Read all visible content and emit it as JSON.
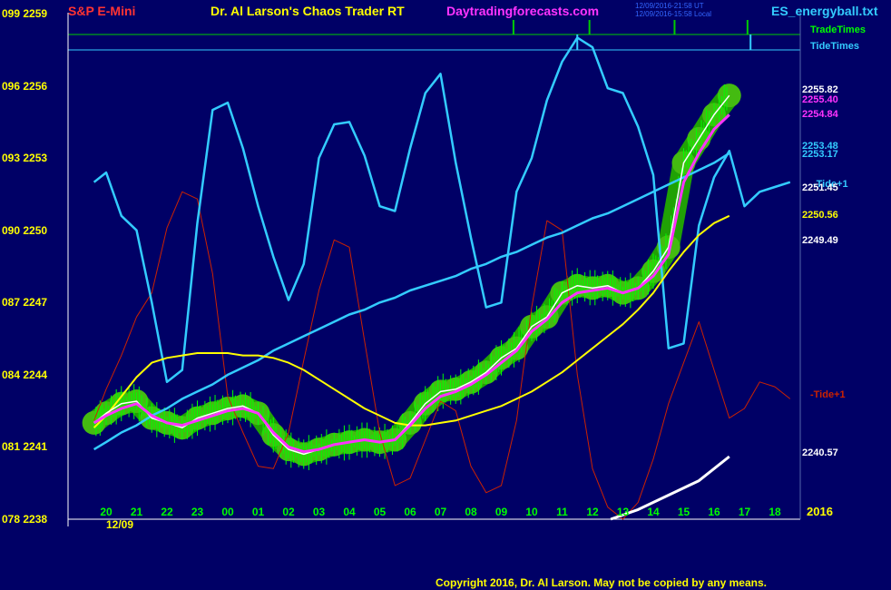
{
  "header": {
    "symbol": "S&P E-Mini",
    "title": "Dr. Al Larson's Chaos Trader RT",
    "site": "Daytradingforecasts.com",
    "stamp1": "12/09/2016-21:58 UT",
    "stamp2": "12/09/2016-15:58 Local",
    "file": "ES_energyball.txt"
  },
  "footer": {
    "copyright": "Copyright 2016, Dr. Al Larson. May not be copied by any means."
  },
  "colors": {
    "background": "#000066",
    "price_bars": "#00FF00",
    "energy_ball": "#22AA00",
    "tide": "#33CCFF",
    "tide_plus1": "#CC2200",
    "avg_fast": "#FF33FF",
    "avg_slow": "#FFFF00",
    "trend": "#33CCFF",
    "white_lines": "#FFFFFF",
    "trade_times": "#00CC00"
  },
  "chart_data": {
    "type": "line",
    "title": "S&P E-Mini",
    "xlabel": "",
    "ylabel": "",
    "ylim": [
      2238,
      2259
    ],
    "y_ticks": [
      {
        "left": "099",
        "right": "2259"
      },
      {
        "left": "096",
        "right": "2256"
      },
      {
        "left": "093",
        "right": "2253"
      },
      {
        "left": "090",
        "right": "2250"
      },
      {
        "left": "087",
        "right": "2247"
      },
      {
        "left": "084",
        "right": "2244"
      },
      {
        "left": "081",
        "right": "2241"
      },
      {
        "left": "078",
        "right": "2238"
      }
    ],
    "x_ticks": [
      "20",
      "21",
      "22",
      "23",
      "00",
      "01",
      "02",
      "03",
      "04",
      "05",
      "06",
      "07",
      "08",
      "09",
      "10",
      "11",
      "12",
      "13",
      "14",
      "15",
      "16",
      "17",
      "18"
    ],
    "date_label": "12/09",
    "year_label": "2016",
    "legend": [
      "TradeTimes",
      "TideTimes"
    ],
    "right_labels": [
      {
        "text": "2255.82",
        "color": "#FFFFFF"
      },
      {
        "text": "2255.40",
        "color": "#FF33FF"
      },
      {
        "text": "2254.84",
        "color": "#FF33FF"
      },
      {
        "text": "2253.48",
        "color": "#33CCFF"
      },
      {
        "text": "2253.17",
        "color": "#33CCFF"
      },
      {
        "text": "-Tide+1",
        "color": "#33CCFF"
      },
      {
        "text": "2251.45",
        "color": "#FFFFFF"
      },
      {
        "text": "2250.56",
        "color": "#FFFF00"
      },
      {
        "text": "2249.49",
        "color": "#FFFFFF"
      },
      {
        "text": "-Tide+1",
        "color": "#CC2200"
      },
      {
        "text": "2240.57",
        "color": "#FFFFFF"
      }
    ],
    "series": [
      {
        "name": "Price",
        "x": [
          19.6,
          20,
          20.5,
          21,
          21.5,
          22,
          22.5,
          23,
          23.5,
          0,
          0.5,
          1,
          1.5,
          2,
          2.5,
          3,
          3.5,
          4,
          4.5,
          5,
          5.5,
          6,
          6.5,
          7,
          7.5,
          8,
          8.5,
          9,
          9.5,
          10,
          10.5,
          11,
          11.5,
          12,
          12.5,
          13,
          13.5,
          14,
          14.5,
          15,
          15.5,
          16,
          16.5
        ],
        "y": [
          2242.0,
          2242.4,
          2242.8,
          2242.9,
          2242.2,
          2242.0,
          2241.8,
          2242.2,
          2242.4,
          2242.6,
          2242.7,
          2242.4,
          2241.5,
          2240.9,
          2240.7,
          2240.9,
          2241.1,
          2241.2,
          2241.3,
          2241.2,
          2241.3,
          2242.0,
          2242.8,
          2243.3,
          2243.4,
          2243.7,
          2244.1,
          2244.7,
          2245.1,
          2246.0,
          2246.4,
          2247.4,
          2247.7,
          2247.6,
          2247.7,
          2247.4,
          2247.6,
          2248.3,
          2249.3,
          2252.8,
          2253.8,
          2254.8,
          2255.6
        ]
      },
      {
        "name": "Fast Average",
        "x": [
          19.6,
          20,
          20.5,
          21,
          21.5,
          22,
          22.5,
          23,
          23.5,
          0,
          0.5,
          1,
          1.5,
          2,
          2.5,
          3,
          3.5,
          4,
          4.5,
          5,
          5.5,
          6,
          6.5,
          7,
          7.5,
          8,
          8.5,
          9,
          9.5,
          10,
          10.5,
          11,
          11.5,
          12,
          12.5,
          13,
          13.5,
          14,
          14.5,
          15,
          15.5,
          16,
          16.5
        ],
        "y": [
          2242.0,
          2242.3,
          2242.6,
          2242.8,
          2242.3,
          2242.0,
          2241.9,
          2242.1,
          2242.3,
          2242.5,
          2242.6,
          2242.4,
          2241.6,
          2241.0,
          2240.8,
          2240.9,
          2241.1,
          2241.2,
          2241.3,
          2241.2,
          2241.3,
          2241.9,
          2242.6,
          2243.1,
          2243.3,
          2243.6,
          2244.0,
          2244.5,
          2245.0,
          2245.8,
          2246.3,
          2247.0,
          2247.4,
          2247.5,
          2247.6,
          2247.4,
          2247.6,
          2248.1,
          2249.0,
          2252.0,
          2253.2,
          2254.2,
          2254.8
        ]
      },
      {
        "name": "Slow Average",
        "x": [
          19.6,
          20,
          20.5,
          21,
          21.5,
          22,
          22.5,
          23,
          23.5,
          0,
          0.5,
          1,
          1.5,
          2,
          2.5,
          3,
          3.5,
          4,
          4.5,
          5,
          5.5,
          6,
          6.5,
          7,
          7.5,
          8,
          8.5,
          9,
          9.5,
          10,
          10.5,
          11,
          11.5,
          12,
          12.5,
          13,
          13.5,
          14,
          14.5,
          15,
          15.5,
          16,
          16.5
        ],
        "y": [
          2241.8,
          2242.3,
          2243.1,
          2243.9,
          2244.5,
          2244.7,
          2244.8,
          2244.9,
          2244.9,
          2244.9,
          2244.8,
          2244.8,
          2244.7,
          2244.5,
          2244.2,
          2243.8,
          2243.4,
          2243.0,
          2242.6,
          2242.3,
          2242.0,
          2241.9,
          2241.9,
          2242.0,
          2242.1,
          2242.3,
          2242.5,
          2242.7,
          2243.0,
          2243.3,
          2243.7,
          2244.1,
          2244.6,
          2245.1,
          2245.6,
          2246.1,
          2246.7,
          2247.4,
          2248.3,
          2249.1,
          2249.8,
          2250.3,
          2250.6
        ]
      },
      {
        "name": "Trend",
        "x": [
          19.6,
          20,
          20.5,
          21,
          21.5,
          22,
          22.5,
          23,
          23.5,
          0,
          0.5,
          1,
          1.5,
          2,
          2.5,
          3,
          3.5,
          4,
          4.5,
          5,
          5.5,
          6,
          6.5,
          7,
          7.5,
          8,
          8.5,
          9,
          9.5,
          10,
          10.5,
          11,
          11.5,
          12,
          12.5,
          13,
          13.5,
          14,
          14.5,
          15,
          15.5,
          16,
          16.5
        ],
        "y": [
          2240.9,
          2241.2,
          2241.6,
          2241.9,
          2242.3,
          2242.6,
          2243.0,
          2243.3,
          2243.6,
          2244.0,
          2244.3,
          2244.6,
          2245.0,
          2245.3,
          2245.6,
          2245.9,
          2246.2,
          2246.5,
          2246.7,
          2247.0,
          2247.2,
          2247.5,
          2247.7,
          2247.9,
          2248.1,
          2248.4,
          2248.6,
          2248.9,
          2249.1,
          2249.4,
          2249.7,
          2249.9,
          2250.2,
          2250.5,
          2250.7,
          2251.0,
          2251.3,
          2251.6,
          2251.9,
          2252.2,
          2252.5,
          2252.8,
          2253.2
        ]
      },
      {
        "name": "Tide",
        "x": [
          19.6,
          20,
          20.5,
          21,
          21.5,
          22,
          22.5,
          23,
          23.5,
          0,
          0.5,
          1,
          1.5,
          2,
          2.5,
          3,
          3.5,
          4,
          4.5,
          5,
          5.5,
          6,
          6.5,
          7,
          7.5,
          8,
          8.5,
          9,
          9.5,
          10,
          10.5,
          11,
          11.5,
          12,
          12.5,
          13,
          13.5,
          14,
          14.5,
          15,
          15.5,
          16,
          16.5,
          17,
          17.5,
          18,
          18.5
        ],
        "y": [
          2252.0,
          2252.4,
          2250.6,
          2250.0,
          2247.0,
          2243.7,
          2244.2,
          2250.3,
          2255.0,
          2255.3,
          2253.4,
          2251.0,
          2248.9,
          2247.1,
          2248.6,
          2253.0,
          2254.4,
          2254.5,
          2253.1,
          2251.0,
          2250.8,
          2253.4,
          2255.7,
          2256.5,
          2252.8,
          2249.7,
          2246.8,
          2247.0,
          2251.6,
          2253.0,
          2255.4,
          2257.0,
          2258.0,
          2257.6,
          2255.9,
          2255.7,
          2254.3,
          2252.3,
          2245.1,
          2245.3,
          2250.2,
          2252.2,
          2253.3,
          2251.0,
          2251.6,
          2251.8,
          2252.0
        ]
      },
      {
        "name": "Tide+1",
        "x": [
          19.6,
          20,
          20.5,
          21,
          21.5,
          22,
          22.5,
          23,
          23.5,
          0,
          0.5,
          1,
          1.5,
          2,
          2.5,
          3,
          3.5,
          4,
          4.5,
          5,
          5.5,
          6,
          6.5,
          7,
          7.5,
          8,
          8.5,
          9,
          9.5,
          10,
          10.5,
          11,
          11.5,
          12,
          12.5,
          13,
          13.5,
          14,
          14.5,
          15,
          15.5,
          16,
          16.5,
          17,
          17.5,
          18,
          18.5
        ],
        "y": [
          2242.1,
          2243.4,
          2244.8,
          2246.4,
          2247.4,
          2250.1,
          2251.6,
          2251.3,
          2248.2,
          2243.1,
          2241.6,
          2240.2,
          2240.1,
          2241.6,
          2244.6,
          2247.5,
          2249.6,
          2249.3,
          2245.4,
          2241.6,
          2239.4,
          2239.7,
          2241.3,
          2242.9,
          2242.5,
          2240.2,
          2239.1,
          2239.4,
          2242.1,
          2246.8,
          2250.4,
          2250.0,
          2244.0,
          2240.1,
          2238.5,
          2238.0,
          2238.7,
          2240.5,
          2242.8,
          2244.5,
          2246.2,
          2244.2,
          2242.2,
          2242.6,
          2243.7,
          2243.5,
          2243.0
        ]
      },
      {
        "name": "Lower Band",
        "x": [
          12.6,
          13.5,
          14.5,
          15.5,
          16.5
        ],
        "y": [
          2238.0,
          2238.4,
          2239.0,
          2239.6,
          2240.6
        ]
      }
    ],
    "trade_times": [
      9.4,
      11.9,
      14.7,
      17.1
    ],
    "tide_times": [
      11.5,
      17.2
    ]
  }
}
